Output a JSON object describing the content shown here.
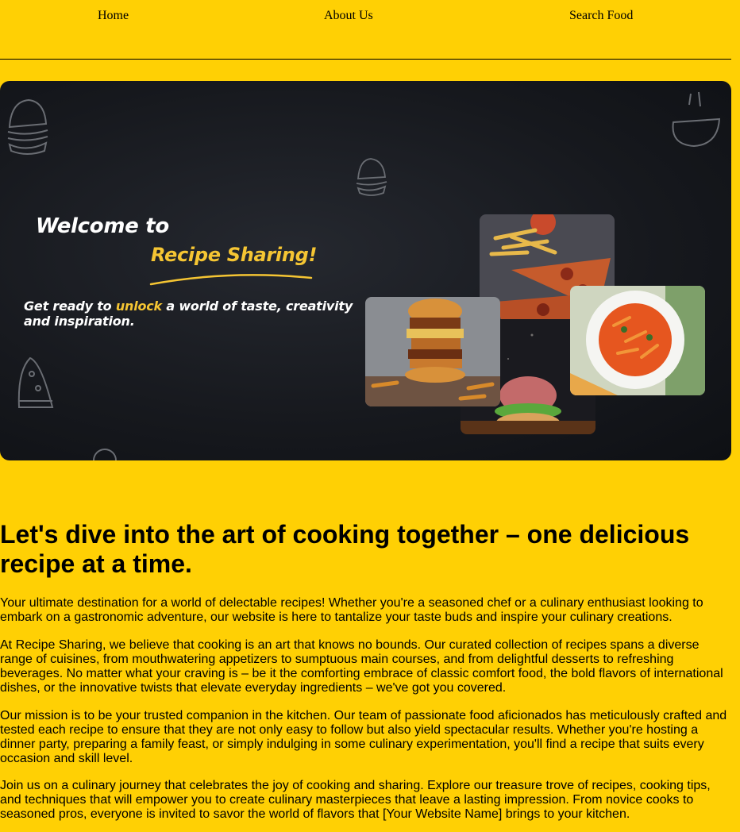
{
  "nav": {
    "home": "Home",
    "about": "About Us",
    "search": "Search Food"
  },
  "hero": {
    "welcome": "Welcome to",
    "brand": "Recipe Sharing!",
    "tagline_pre": "Get ready to ",
    "tagline_highlight": "unlock",
    "tagline_post": " a world of taste, creativity and inspiration.",
    "accent_color": "#f5c533",
    "background_color": "#16181d",
    "images": [
      "burger-stack-photo",
      "fries-pizza-photo",
      "pasta-plate-photo",
      "grilled-burger-photo"
    ]
  },
  "content": {
    "heading": "Let's dive into the art of cooking together – one delicious recipe at a time.",
    "paragraphs": [
      "Your ultimate destination for a world of delectable recipes! Whether you're a seasoned chef or a culinary enthusiast looking to embark on a gastronomic adventure, our website is here to tantalize your taste buds and inspire your culinary creations.",
      "At Recipe Sharing, we believe that cooking is an art that knows no bounds. Our curated collection of recipes spans a diverse range of cuisines, from mouthwatering appetizers to sumptuous main courses, and from delightful desserts to refreshing beverages. No matter what your craving is – be it the comforting embrace of classic comfort food, the bold flavors of international dishes, or the innovative twists that elevate everyday ingredients – we've got you covered.",
      "Our mission is to be your trusted companion in the kitchen. Our team of passionate food aficionados has meticulously crafted and tested each recipe to ensure that they are not only easy to follow but also yield spectacular results. Whether you're hosting a dinner party, preparing a family feast, or simply indulging in some culinary experimentation, you'll find a recipe that suits every occasion and skill level.",
      "Join us on a culinary journey that celebrates the joy of cooking and sharing. Explore our treasure trove of recipes, cooking tips, and techniques that will empower you to create culinary masterpieces that leave a lasting impression. From novice cooks to seasoned pros, everyone is invited to savor the world of flavors that [Your Website Name] brings to your kitchen."
    ]
  },
  "colors": {
    "page_background": "#ffd004",
    "text": "#000000"
  }
}
